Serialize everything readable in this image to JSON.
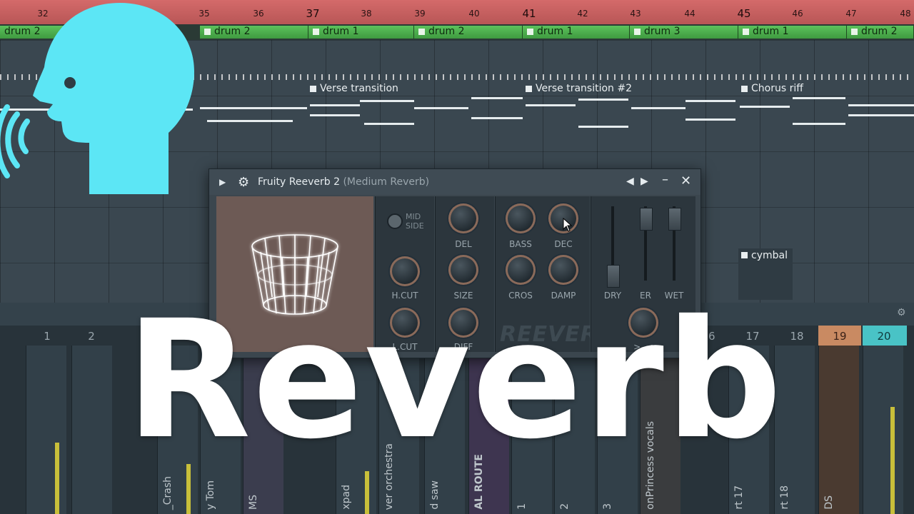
{
  "ruler": {
    "ticks": [
      {
        "label": "32",
        "major": false
      },
      {
        "label": "35",
        "major": false
      },
      {
        "label": "36",
        "major": false
      },
      {
        "label": "37",
        "major": true
      },
      {
        "label": "38",
        "major": false
      },
      {
        "label": "39",
        "major": false
      },
      {
        "label": "40",
        "major": false
      },
      {
        "label": "41",
        "major": true
      },
      {
        "label": "42",
        "major": false
      },
      {
        "label": "43",
        "major": false
      },
      {
        "label": "44",
        "major": false
      },
      {
        "label": "45",
        "major": true
      },
      {
        "label": "46",
        "major": false
      },
      {
        "label": "47",
        "major": false
      },
      {
        "label": "48",
        "major": false
      }
    ]
  },
  "drum_clips": [
    "drum 2",
    "drum 2",
    "drum 1",
    "drum 2",
    "drum 1",
    "drum 3",
    "drum 1",
    "drum 2"
  ],
  "pattern_labels": [
    "Verse transition",
    "Verse transition #2",
    "Chorus riff"
  ],
  "cymbal_label": "cymbal",
  "plugin": {
    "title": "Fruity Reeverb 2",
    "preset": "(Medium Reverb)",
    "midside_label_1": "MID",
    "midside_label_2": "SIDE",
    "knobs": {
      "del": "DEL",
      "hcut": "H.CUT",
      "lcut": "L.CUT",
      "size": "SIZE",
      "diff": "DIFF",
      "bass": "BASS",
      "dec": "DEC",
      "cros": "CROS",
      "damp": "DAMP"
    },
    "faders": {
      "dry": "DRY",
      "er": "ER",
      "wet": "WET"
    },
    "mix_knob_label": ">..<",
    "brand": "REEVERB 2",
    "icons": [
      "chevron-right-icon",
      "gear-icon",
      "arrow-left-icon",
      "arrow-right-icon",
      "minimize-icon",
      "close-icon"
    ]
  },
  "mixer": {
    "insert_numbers": [
      "1",
      "2",
      "16",
      "17",
      "18",
      "19",
      "20"
    ],
    "strip_labels": [
      "_Crash",
      "y Tom",
      "MS",
      "xpad",
      "ver orchestra",
      "d saw",
      "AL ROUTE",
      "1",
      "2",
      "3",
      "onPrincess vocals",
      "rt 17",
      "rt 18",
      "DS"
    ]
  },
  "overlay": {
    "title": "Reverb"
  },
  "colors": {
    "ruler": "#d46a6a",
    "drum_clip": "#4fae50",
    "head_icon": "#5ce6f5",
    "insert_19": "#c98a62",
    "insert_20": "#49c3c6"
  }
}
